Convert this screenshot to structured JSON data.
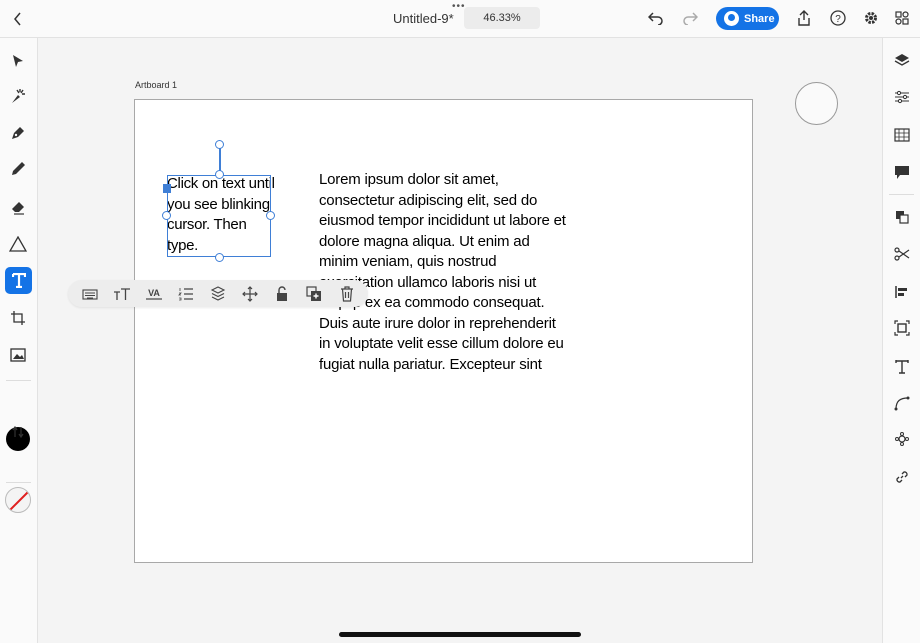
{
  "header": {
    "back_icon": "chevron-left-icon",
    "title": "Untitled-9*",
    "zoom": "46.33%",
    "share_label": "Share",
    "icons": [
      "undo-icon",
      "redo-icon",
      "export-icon",
      "help-icon",
      "settings-icon",
      "plugins-icon"
    ]
  },
  "left_tools": [
    "selection-tool-icon",
    "direct-selection-tool-icon",
    "pen-tool-icon",
    "pencil-tool-icon",
    "eraser-tool-icon",
    "shape-tool-icon",
    "type-tool-icon",
    "crop-tool-icon",
    "image-tool-icon",
    "fill-color-icon",
    "swap-colors-icon",
    "stroke-color-icon"
  ],
  "active_tool": "type-tool-icon",
  "fill_color": "#000000",
  "accent_color": "#1473e6",
  "right_panel": [
    "layers-icon",
    "properties-icon",
    "swatches-icon",
    "comments-icon",
    "arrange-icon",
    "cut-icon",
    "align-icon",
    "transform-icon",
    "type-panel-icon",
    "path-icon",
    "repeat-icon",
    "link-icon"
  ],
  "artboard": {
    "label": "Artboard 1",
    "selected_text": "Click on text until you see blinking cursor. Then type.",
    "body_text": "Lorem ipsum dolor sit amet, consectetur adipiscing elit, sed do eiusmod tempor incididunt ut labore et dolore magna aliqua. Ut enim ad minim veniam, quis nostrud exercitation ullamco laboris nisi ut aliquip ex ea commodo consequat. Duis aute irure dolor in reprehenderit in voluptate velit esse cillum dolore eu fugiat nulla pariatur. Excepteur sint"
  },
  "context_toolbar": [
    "keyboard-icon",
    "font-size-icon",
    "tracking-icon",
    "list-icon",
    "layers-stack-icon",
    "move-icon",
    "unlock-icon",
    "duplicate-icon",
    "delete-icon"
  ]
}
